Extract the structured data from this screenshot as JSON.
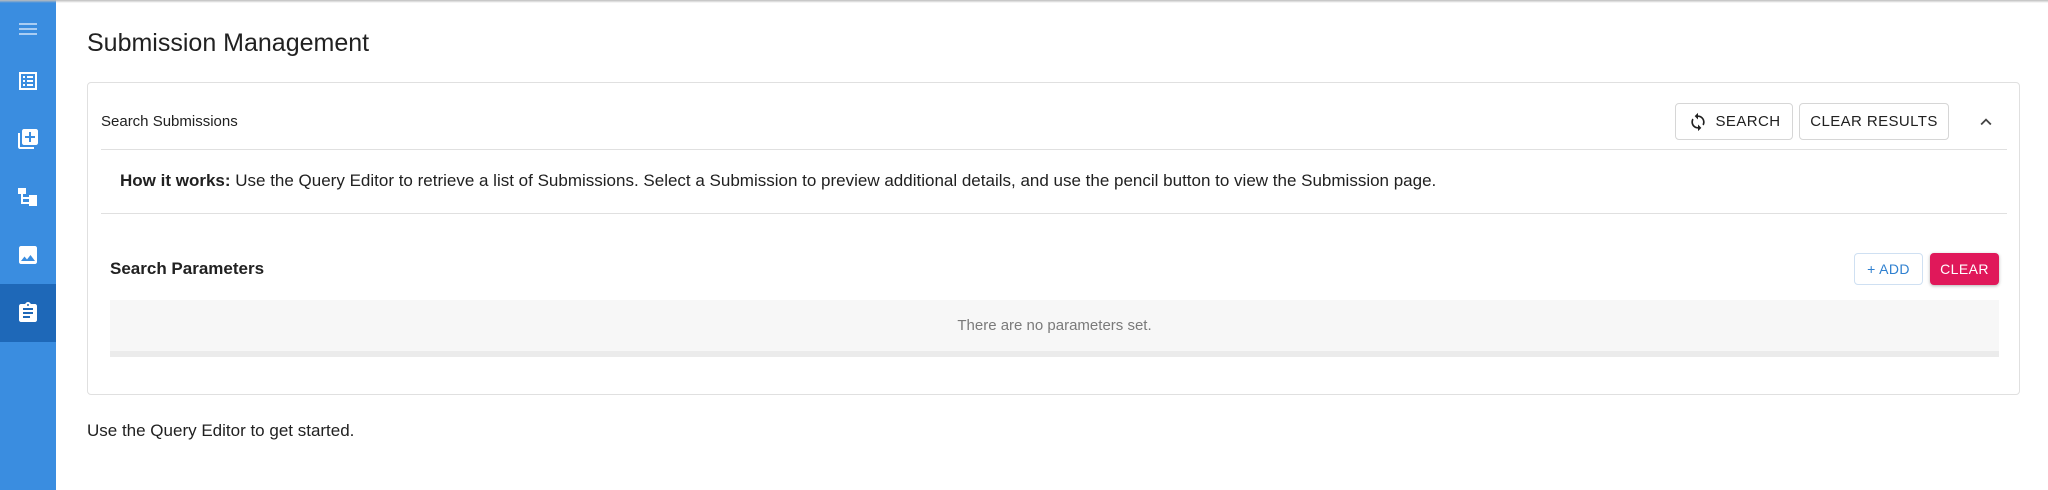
{
  "sidebar": {
    "items": [
      {
        "icon": "menu-icon",
        "active": false
      },
      {
        "icon": "list-icon",
        "active": false
      },
      {
        "icon": "add-collection-icon",
        "active": false
      },
      {
        "icon": "hierarchy-icon",
        "active": false
      },
      {
        "icon": "image-icon",
        "active": false
      },
      {
        "icon": "clipboard-icon",
        "active": true
      }
    ],
    "colors": {
      "background": "#3a8de0",
      "active": "#1e68b8"
    }
  },
  "page": {
    "title": "Submission Management"
  },
  "search_panel": {
    "title": "Search Submissions",
    "search_button": "SEARCH",
    "clear_results_button": "CLEAR RESULTS",
    "collapse_icon": "chevron-up-icon",
    "info_label": "How it works:",
    "info_text": " Use the Query Editor to retrieve a list of Submissions. Select a Submission to preview additional details, and use the pencil button to view the Submission page.",
    "parameters": {
      "title": "Search Parameters",
      "add_button": "+ ADD",
      "clear_button": "CLEAR",
      "empty_message": "There are no parameters set."
    }
  },
  "footer": {
    "message": "Use the Query Editor to get started."
  },
  "colors": {
    "accent": "#2f80d0",
    "danger": "#e0185a"
  }
}
